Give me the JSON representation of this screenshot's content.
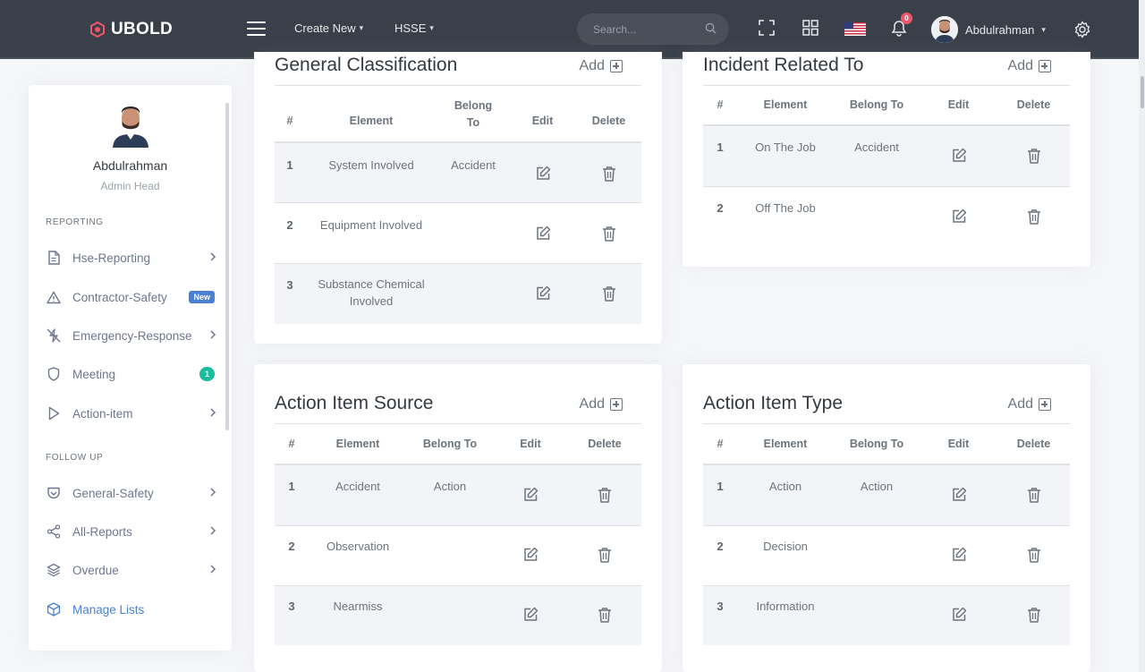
{
  "topbar": {
    "logo_text": "UBOLD",
    "nav": [
      {
        "label": "Create New"
      },
      {
        "label": "HSSE"
      }
    ],
    "search_placeholder": "Search...",
    "notification_count": "0",
    "user_name": "Abdulrahman"
  },
  "sidebar": {
    "profile_name": "Abdulrahman",
    "profile_role": "Admin Head",
    "section_reporting": "REPORTING",
    "section_followup": "FOLLOW UP",
    "items": [
      {
        "label": "Hse-Reporting",
        "icon": "document-icon"
      },
      {
        "label": "Contractor-Safety",
        "icon": "warning-icon",
        "badge": "New"
      },
      {
        "label": "Emergency-Response",
        "icon": "zap-off-icon"
      },
      {
        "label": "Meeting",
        "icon": "shield-icon",
        "badge": "1"
      },
      {
        "label": "Action-item",
        "icon": "play-icon"
      },
      {
        "label": "General-Safety",
        "icon": "pocket-icon"
      },
      {
        "label": "All-Reports",
        "icon": "share-icon"
      },
      {
        "label": "Overdue",
        "icon": "layers-icon"
      },
      {
        "label": "Manage Lists",
        "icon": "box-icon"
      }
    ]
  },
  "common": {
    "add_label": "Add",
    "col_num": "#",
    "col_element": "Element",
    "col_belong": "Belong To",
    "col_belong_line1": "Belong",
    "col_belong_line2": "To",
    "col_edit": "Edit",
    "col_delete": "Delete"
  },
  "cards": {
    "general": {
      "title": "General Classification",
      "rows": [
        {
          "num": "1",
          "element": "System Involved",
          "belong": "Accident"
        },
        {
          "num": "2",
          "element": "Equipment Involved",
          "belong": ""
        },
        {
          "num": "3",
          "element_line1": "Substance Chemical",
          "element_line2": "Involved",
          "belong": ""
        }
      ]
    },
    "incident": {
      "title": "Incident Related To",
      "rows": [
        {
          "num": "1",
          "element": "On The Job",
          "belong": "Accident"
        },
        {
          "num": "2",
          "element": "Off The Job",
          "belong": ""
        }
      ]
    },
    "source": {
      "title": "Action Item Source",
      "rows": [
        {
          "num": "1",
          "element": "Accident",
          "belong": "Action"
        },
        {
          "num": "2",
          "element": "Observation",
          "belong": ""
        },
        {
          "num": "3",
          "element": "Nearmiss",
          "belong": ""
        }
      ]
    },
    "type": {
      "title": "Action Item Type",
      "rows": [
        {
          "num": "1",
          "element": "Action",
          "belong": "Action"
        },
        {
          "num": "2",
          "element": "Decision",
          "belong": ""
        },
        {
          "num": "3",
          "element": "Information",
          "belong": ""
        }
      ]
    }
  }
}
